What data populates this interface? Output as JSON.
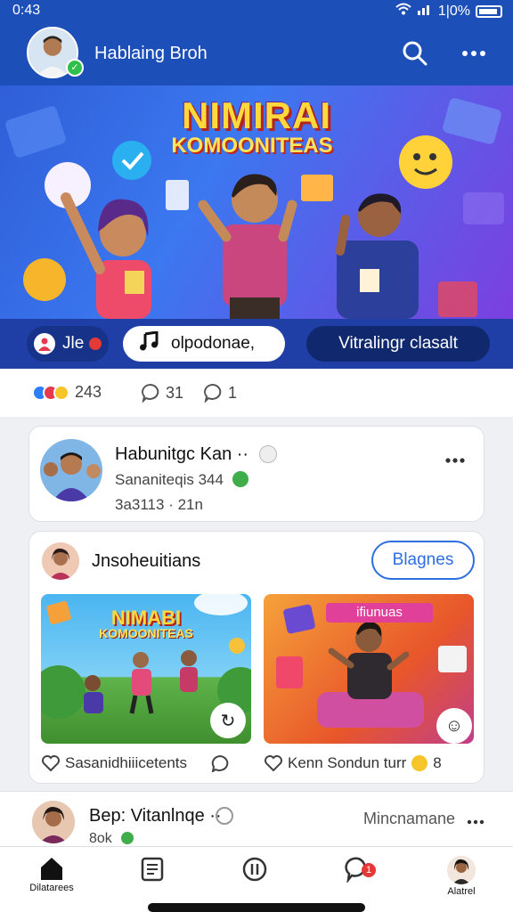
{
  "status": {
    "time": "0:43",
    "battery": "1|0%"
  },
  "header": {
    "title": "Hablaing Broh",
    "search_icon": "search-icon",
    "more_icon": "more-icon"
  },
  "hero": {
    "title_line1": "NIMIRAI",
    "title_line2": "KOMOONITEAS"
  },
  "chips": [
    {
      "label": "Jle",
      "icon": "profile-icon"
    },
    {
      "label": "olpodonae,",
      "icon": "music-note-icon"
    },
    {
      "label": "Vitralingr clasalt"
    }
  ],
  "reactions": {
    "likes": "243",
    "comments": "31",
    "shares": "1"
  },
  "post1": {
    "name": "Habunitgc Kan ··",
    "line1": "Sananiteqis 344",
    "line2": "3a3113 · 21n"
  },
  "post2": {
    "name": "Jnsoheuitians",
    "button": "Blagnes",
    "thumb1": {
      "title_line1": "NIMABI",
      "title_line2": "KOMOONITEAS"
    },
    "thumb2": {
      "banner": "ifiunuas"
    },
    "caption1": "Sasanidhiiicetents",
    "caption2": "Kenn Sondun turr",
    "caption2_count": "8"
  },
  "post3": {
    "name": "Bep: Vitanlnqe ··",
    "sub": "8ok",
    "right": "Mincnamane"
  },
  "nav": [
    {
      "label": "Dilatarees",
      "icon": "home-icon"
    },
    {
      "label": "",
      "icon": "news-icon"
    },
    {
      "label": "",
      "icon": "refresh-icon"
    },
    {
      "label": "",
      "icon": "notifications-icon",
      "badge": "1"
    },
    {
      "label": "Alatrel",
      "icon": "profile-avatar"
    }
  ],
  "colors": {
    "brand": "#1d4fb8",
    "accent": "#2c6fe0",
    "badge": "#e53935"
  }
}
